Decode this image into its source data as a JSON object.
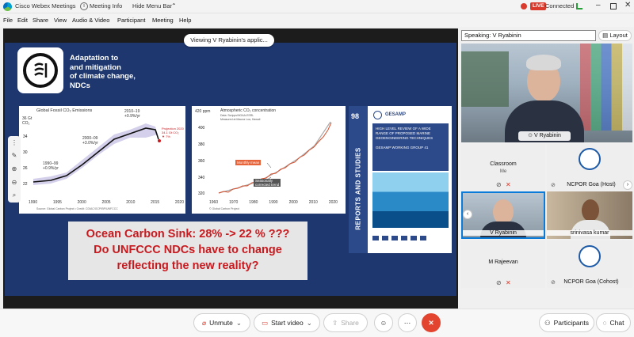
{
  "window": {
    "app_title": "Cisco Webex Meetings",
    "meeting_info": "Meeting Info",
    "hide_menu_bar": "Hide Menu Bar",
    "live_label": "LIVE",
    "connection_status": "Connected"
  },
  "menu": {
    "file": "File",
    "edit": "Edit",
    "share": "Share",
    "view": "View",
    "audio_video": "Audio & Video",
    "participant": "Participant",
    "meeting": "Meeting",
    "help": "Help"
  },
  "share": {
    "viewing_label": "Viewing V Ryabinin's applic..."
  },
  "slide": {
    "heading_lines": [
      "Adaptation to",
      "and mitigation",
      "of climate change,",
      "NDCs"
    ],
    "chart1": {
      "title": "Global Fossil CO₂ Emissions",
      "y_unit": [
        "36 Gt",
        "CO₂"
      ],
      "y_ticks": [
        "34",
        "30",
        "26",
        "22"
      ],
      "x_ticks": [
        "1990",
        "1995",
        "2000",
        "2005",
        "2010",
        "2015",
        "2020"
      ],
      "annotations": {
        "a1990": [
          "1990–99",
          "+0.9%/yr"
        ],
        "a2000": [
          "2000–09",
          "+3.0%/yr"
        ],
        "a2010": [
          "2010–19",
          "+0.9%/yr"
        ],
        "proj": [
          "Projection 2020",
          "34.1 Gt CO₂",
          "▼ 7%"
        ]
      },
      "source": "Source: Global Carbon Project  •  Credit: CDIAC/GCP/BP/UNFCCC"
    },
    "chart2": {
      "title": "Atmospheric CO₂ concentration",
      "y_unit": "420 ppm",
      "subtitle": [
        "Data: Scripps/NOAA-ESRL",
        "Measured at Mauna Loa, Hawaii"
      ],
      "y_ticks": [
        "400",
        "380",
        "360",
        "340",
        "320"
      ],
      "x_ticks": [
        "1960",
        "1970",
        "1980",
        "1990",
        "2000",
        "2010",
        "2020"
      ],
      "monthly_label": "Monthly mean",
      "corrected_label": [
        "Seasonally",
        "corrected trend"
      ],
      "source": "© Global Carbon Project"
    },
    "report": {
      "number": "98",
      "side_text": "REPORTS AND STUDIES",
      "org": "GESAMP",
      "title_lines": [
        "HIGH LEVEL REVIEW OF A WIDE",
        "RANGE OF PROPOSED MARINE",
        "GEOENGINEERING TECHNIQUES"
      ],
      "group": "GESAMP WORKING GROUP 41"
    },
    "callout_lines": [
      "Ocean Carbon Sink: 28% -> 22 % ???",
      "Do UNFCCC NDCs have to change",
      "reflecting the new reality?"
    ]
  },
  "panel": {
    "speaking_label": "Speaking: V Ryabinin",
    "layout_label": "Layout",
    "speaker_name": "V Ryabinin",
    "tiles": [
      {
        "name": "Classroom",
        "sub": "Me"
      },
      {
        "name": "NCPOR Goa",
        "sub": "(Host)"
      },
      {
        "name": "V Ryabinin",
        "sub": ""
      },
      {
        "name": "srinivasa kumar",
        "sub": ""
      },
      {
        "name": "M Rajeevan",
        "sub": ""
      },
      {
        "name": "NCPOR Goa",
        "sub": "(Cohost)"
      }
    ]
  },
  "controls": {
    "unmute": "Unmute",
    "start_video": "Start video",
    "share": "Share",
    "participants": "Participants",
    "chat": "Chat"
  },
  "colors": {
    "slide_bg": "#1e376f",
    "callout_text": "#c8191e",
    "end_button": "#e2442f",
    "active_border": "#0a7bd8",
    "mute_red": "#d93a2b"
  }
}
